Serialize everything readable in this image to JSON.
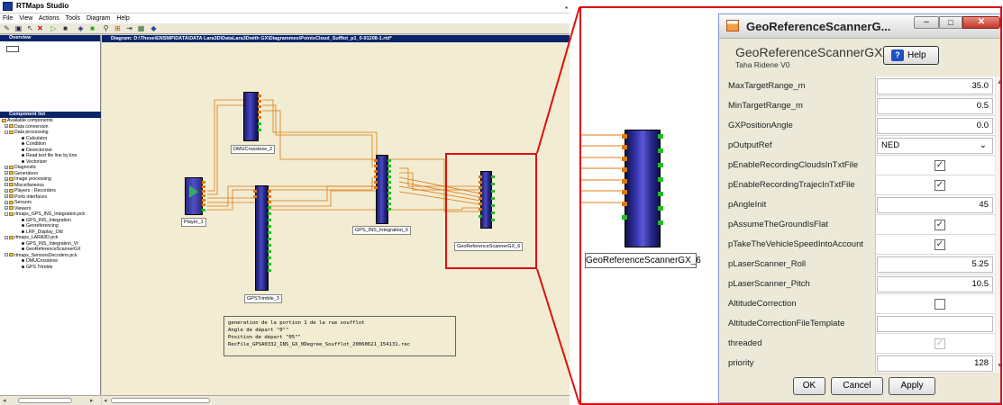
{
  "app": {
    "title": "RTMaps Studio",
    "menu": [
      "File",
      "View",
      "Actions",
      "Tools",
      "Diagram",
      "Help"
    ]
  },
  "overview": {
    "title": "Overview"
  },
  "component_list": {
    "title": "Component list",
    "items": [
      "Available components",
      "Data conversion",
      "Data processing",
      "Calculator",
      "Condition",
      "Devectorizer",
      "Read text file line by line",
      "Vectorizer",
      "Diagnostic",
      "Generators",
      "Image processing",
      "Miscellaneous",
      "Players - Recorders",
      "Ports interfaces",
      "Sensors",
      "Viewers",
      "rtmaps_GPS_INS_Integration.pck",
      "GPS_INS_Integration",
      "Georeferencing",
      "LRF_Display_Old",
      "rtmaps_LARA3D.pck",
      "GPS_INS_Integration_Vt",
      "GeoReferenceScannerGX",
      "rtmaps_SensorsDecoders.pck",
      "DMUCrossbow",
      "GPS Trimble"
    ]
  },
  "diagram": {
    "title": "Diagram: D:\\These\\ENSMP\\DATA\\DATA Lara3D\\DataLara3Dwith GX\\Diagrammes\\PointsCloud_Sufflot_p1_0-91208-1.rtd*",
    "components": {
      "player": "Player_1",
      "dmu": "DMUCrossbow_2",
      "gpstrimble": "GPSTrimble_3",
      "gpsins": "GPS_INS_Integration_6",
      "georef": "GeoReferenceScannerGX_6"
    },
    "note": [
      "generation de la portion 1 de la rue soufflot",
      "Angle de départ \"0\"\"",
      "Position de départ \"05\"\"",
      "RecFile_GPSA0332_INS_GX_0Degree_Soufflot_20060621_154131.rec"
    ]
  },
  "zoom": {
    "component_label": "GeoReferenceScannerGX_6"
  },
  "dialog": {
    "title": "GeoReferenceScannerG...",
    "component_name": "GeoReferenceScannerGX",
    "author": "Taha Ridene V0",
    "help_label": "Help",
    "properties": [
      {
        "name": "MaxTargetRange_m",
        "type": "text",
        "value": "35.0"
      },
      {
        "name": "MinTargetRange_m",
        "type": "text",
        "value": "0.5"
      },
      {
        "name": "GXPositionAngle",
        "type": "text",
        "value": "0.0"
      },
      {
        "name": "pOutputRef",
        "type": "select",
        "value": "NED"
      },
      {
        "name": "pEnableRecordingCloudsInTxtFile",
        "type": "check",
        "value": "✓"
      },
      {
        "name": "pEnableRecordingTrajecInTxtFile",
        "type": "check",
        "value": "✓"
      },
      {
        "name": "pAngleInit",
        "type": "text",
        "value": "45"
      },
      {
        "name": "pAssumeTheGroundIsFlat",
        "type": "check",
        "value": "✓"
      },
      {
        "name": "pTakeTheVehicleSpeedIntoAccount",
        "type": "check",
        "value": "✓"
      },
      {
        "name": "pLaserScanner_Roll",
        "type": "text",
        "value": "5.25"
      },
      {
        "name": "pLaserScanner_Pitch",
        "type": "text",
        "value": "10.5"
      },
      {
        "name": "AltitudeCorrection",
        "type": "check",
        "value": ""
      },
      {
        "name": "AltitudeCorrectionFileTemplate",
        "type": "text",
        "value": ""
      },
      {
        "name": "threaded",
        "type": "check-disabled",
        "value": "✓"
      },
      {
        "name": "priority",
        "type": "text",
        "value": "128"
      }
    ],
    "buttons": {
      "ok": "OK",
      "cancel": "Cancel",
      "apply": "Apply"
    }
  },
  "colors": {
    "highlight": "#e01010",
    "diagram_bg": "#f1ecd2",
    "component": "#2a2a90"
  }
}
